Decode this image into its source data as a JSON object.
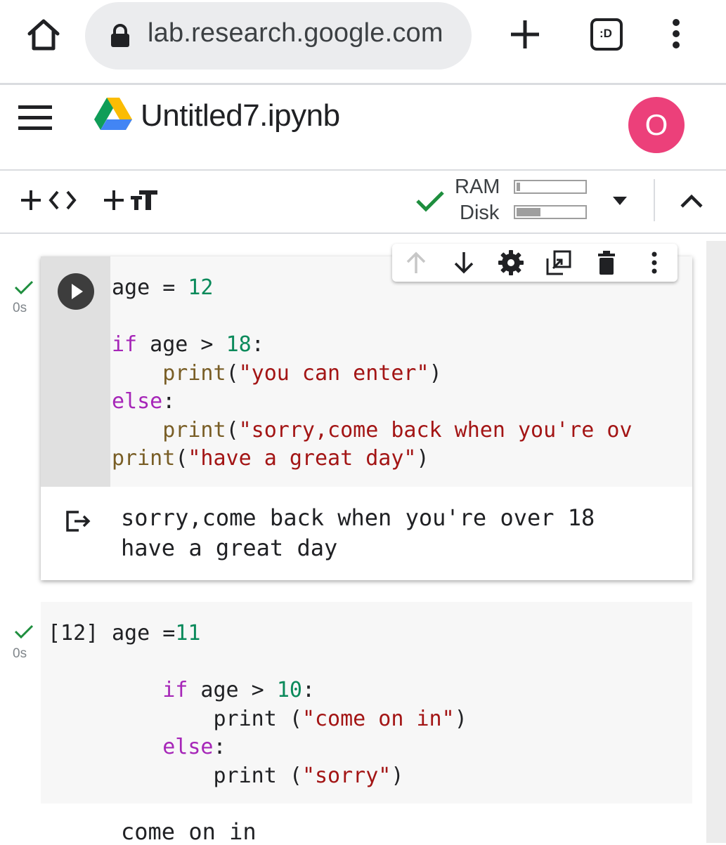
{
  "browser": {
    "url": "lab.research.google.com",
    "tab_count": ":D"
  },
  "notebook": {
    "title": "Untitled7.ipynb",
    "avatar_initial": "O"
  },
  "toolbar": {
    "add_code_icon": "plus-code-icon",
    "add_text_icon": "plus-text-icon",
    "ram_label": "RAM",
    "disk_label": "Disk",
    "ram_usage": 0.05,
    "disk_usage": 0.35
  },
  "cells": [
    {
      "status": "check",
      "exec_time": "0s",
      "code_lines": [
        "age = 12",
        "",
        "if age > 18:",
        "    print(\"you can enter\")",
        "else:",
        "    print(\"sorry,come back when you're ov",
        "print(\"have a great day\")"
      ],
      "output_lines": [
        "sorry,come back when you're over 18",
        "have a great day"
      ]
    },
    {
      "status": "check",
      "exec_time": "0s",
      "execution_count": "[12]",
      "code_lines": [
        "age =11",
        "",
        "    if age > 10:",
        "        print (\"come on in\")",
        "    else:",
        "        print (\"sorry\")"
      ],
      "output_lines": [
        "come on in"
      ]
    }
  ],
  "colors": {
    "keyword": "#a626b8",
    "number": "#0b8a5b",
    "string": "#a31515",
    "function": "#795e26",
    "avatar": "#ec407a",
    "check": "#1e8e3e"
  }
}
